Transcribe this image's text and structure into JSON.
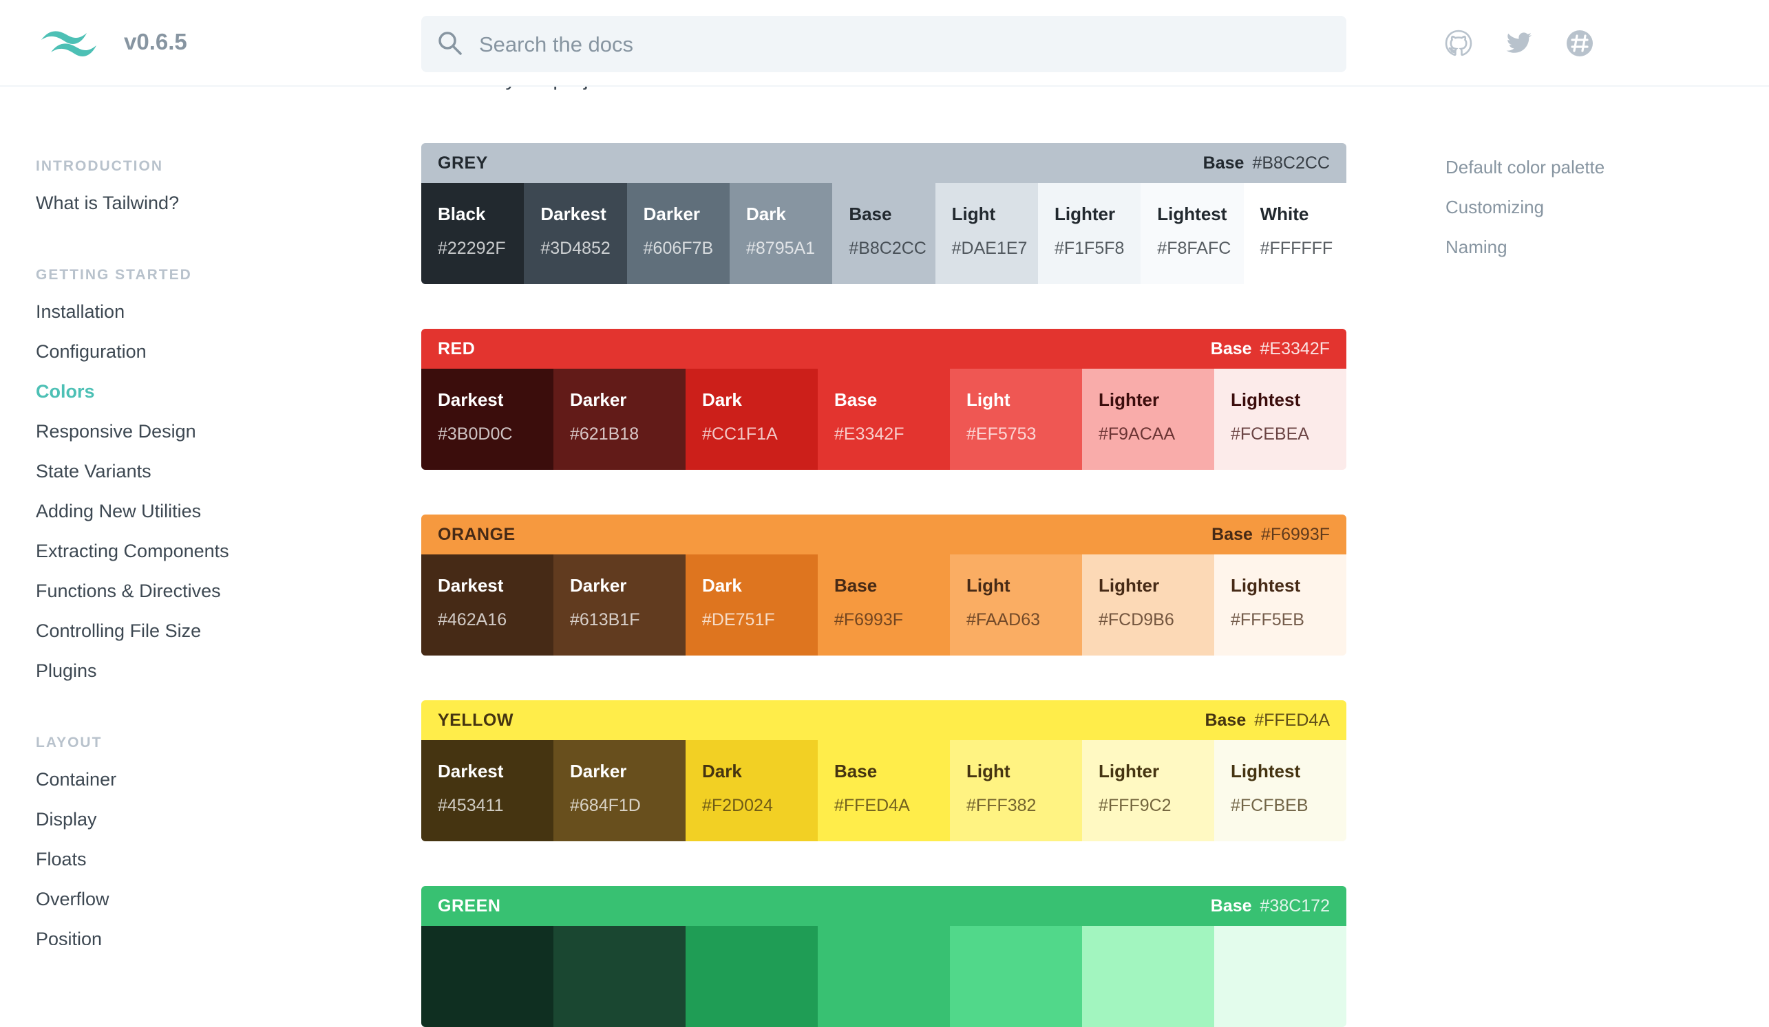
{
  "header": {
    "version": "v0.6.5",
    "search_placeholder": "Search the docs",
    "icons": [
      "github-icon",
      "twitter-icon",
      "slack-icon"
    ]
  },
  "sidebar": {
    "sections": [
      {
        "heading": "INTRODUCTION",
        "items": [
          {
            "label": "What is Tailwind?"
          }
        ]
      },
      {
        "heading": "GETTING STARTED",
        "items": [
          {
            "label": "Installation"
          },
          {
            "label": "Configuration"
          },
          {
            "label": "Colors",
            "active": true
          },
          {
            "label": "Responsive Design"
          },
          {
            "label": "State Variants"
          },
          {
            "label": "Adding New Utilities"
          },
          {
            "label": "Extracting Components"
          },
          {
            "label": "Functions & Directives"
          },
          {
            "label": "Controlling File Size"
          },
          {
            "label": "Plugins"
          }
        ]
      },
      {
        "heading": "LAYOUT",
        "items": [
          {
            "label": "Container"
          },
          {
            "label": "Display"
          },
          {
            "label": "Floats"
          },
          {
            "label": "Overflow"
          },
          {
            "label": "Position"
          }
        ]
      }
    ]
  },
  "content": {
    "cut_text": "them for your project.",
    "palettes": [
      {
        "name": "GREY",
        "base_label": "Base",
        "base_hex": "#B8C2CC",
        "header_bg": "#B8C2CC",
        "header_fg": "#22292F",
        "swatches": [
          {
            "name": "Black",
            "hex": "#22292F",
            "fg": "#FFFFFF"
          },
          {
            "name": "Darkest",
            "hex": "#3D4852",
            "fg": "#FFFFFF"
          },
          {
            "name": "Darker",
            "hex": "#606F7B",
            "fg": "#FFFFFF"
          },
          {
            "name": "Dark",
            "hex": "#8795A1",
            "fg": "#FFFFFF"
          },
          {
            "name": "Base",
            "hex": "#B8C2CC",
            "fg": "#22292F"
          },
          {
            "name": "Light",
            "hex": "#DAE1E7",
            "fg": "#22292F"
          },
          {
            "name": "Lighter",
            "hex": "#F1F5F8",
            "fg": "#22292F"
          },
          {
            "name": "Lightest",
            "hex": "#F8FAFC",
            "fg": "#22292F"
          },
          {
            "name": "White",
            "hex": "#FFFFFF",
            "fg": "#22292F"
          }
        ]
      },
      {
        "name": "RED",
        "base_label": "Base",
        "base_hex": "#E3342F",
        "header_bg": "#E3342F",
        "header_fg": "#FFFFFF",
        "swatches": [
          {
            "name": "Darkest",
            "hex": "#3B0D0C",
            "fg": "#FFFFFF"
          },
          {
            "name": "Darker",
            "hex": "#621B18",
            "fg": "#FFFFFF"
          },
          {
            "name": "Dark",
            "hex": "#CC1F1A",
            "fg": "#FFFFFF"
          },
          {
            "name": "Base",
            "hex": "#E3342F",
            "fg": "#FFFFFF"
          },
          {
            "name": "Light",
            "hex": "#EF5753",
            "fg": "#FFFFFF"
          },
          {
            "name": "Lighter",
            "hex": "#F9ACAA",
            "fg": "#3B0D0C"
          },
          {
            "name": "Lightest",
            "hex": "#FCEBEA",
            "fg": "#3B0D0C"
          }
        ]
      },
      {
        "name": "ORANGE",
        "base_label": "Base",
        "base_hex": "#F6993F",
        "header_bg": "#F6993F",
        "header_fg": "#462A16",
        "swatches": [
          {
            "name": "Darkest",
            "hex": "#462A16",
            "fg": "#FFFFFF"
          },
          {
            "name": "Darker",
            "hex": "#613B1F",
            "fg": "#FFFFFF"
          },
          {
            "name": "Dark",
            "hex": "#DE751F",
            "fg": "#FFFFFF"
          },
          {
            "name": "Base",
            "hex": "#F6993F",
            "fg": "#462A16"
          },
          {
            "name": "Light",
            "hex": "#FAAD63",
            "fg": "#462A16"
          },
          {
            "name": "Lighter",
            "hex": "#FCD9B6",
            "fg": "#462A16"
          },
          {
            "name": "Lightest",
            "hex": "#FFF5EB",
            "fg": "#462A16"
          }
        ]
      },
      {
        "name": "YELLOW",
        "base_label": "Base",
        "base_hex": "#FFED4A",
        "header_bg": "#FFED4A",
        "header_fg": "#453411",
        "swatches": [
          {
            "name": "Darkest",
            "hex": "#453411",
            "fg": "#FFFFFF"
          },
          {
            "name": "Darker",
            "hex": "#684F1D",
            "fg": "#FFFFFF"
          },
          {
            "name": "Dark",
            "hex": "#F2D024",
            "fg": "#453411"
          },
          {
            "name": "Base",
            "hex": "#FFED4A",
            "fg": "#453411"
          },
          {
            "name": "Light",
            "hex": "#FFF382",
            "fg": "#453411"
          },
          {
            "name": "Lighter",
            "hex": "#FFF9C2",
            "fg": "#453411"
          },
          {
            "name": "Lightest",
            "hex": "#FCFBEB",
            "fg": "#453411"
          }
        ]
      },
      {
        "name": "GREEN",
        "base_label": "Base",
        "base_hex": "#38C172",
        "header_bg": "#38C172",
        "header_fg": "#FFFFFF",
        "swatches": [
          {
            "name": "",
            "hex": "",
            "color": "#0F2F21",
            "fg": "#FFFFFF"
          },
          {
            "name": "",
            "hex": "",
            "color": "#1A4731",
            "fg": "#FFFFFF"
          },
          {
            "name": "",
            "hex": "",
            "color": "#1F9D55",
            "fg": "#FFFFFF"
          },
          {
            "name": "",
            "hex": "",
            "color": "#38C172",
            "fg": "#FFFFFF"
          },
          {
            "name": "",
            "hex": "",
            "color": "#51D88A",
            "fg": "#FFFFFF"
          },
          {
            "name": "",
            "hex": "",
            "color": "#A2F5BF",
            "fg": "#0F2F21"
          },
          {
            "name": "",
            "hex": "",
            "color": "#E3FCEC",
            "fg": "#0F2F21"
          }
        ]
      }
    ]
  },
  "toc": {
    "items": [
      {
        "label": "Default color palette"
      },
      {
        "label": "Customizing"
      },
      {
        "label": "Naming"
      }
    ]
  },
  "colors": {
    "accent": "#4dc0b5",
    "muted": "#8795a1",
    "heading_muted": "#b8c2cc",
    "search_bg": "#f1f5f8"
  }
}
